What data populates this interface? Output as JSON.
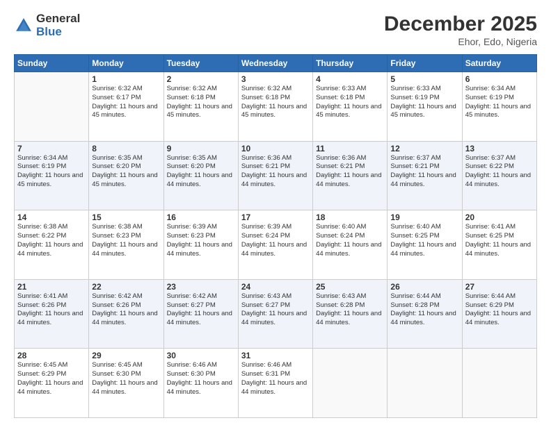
{
  "logo": {
    "line1": "General",
    "line2": "Blue"
  },
  "header": {
    "month": "December 2025",
    "location": "Ehor, Edo, Nigeria"
  },
  "weekdays": [
    "Sunday",
    "Monday",
    "Tuesday",
    "Wednesday",
    "Thursday",
    "Friday",
    "Saturday"
  ],
  "weeks": [
    [
      {
        "day": "",
        "sunrise": "",
        "sunset": "",
        "daylight": ""
      },
      {
        "day": "1",
        "sunrise": "Sunrise: 6:32 AM",
        "sunset": "Sunset: 6:17 PM",
        "daylight": "Daylight: 11 hours and 45 minutes."
      },
      {
        "day": "2",
        "sunrise": "Sunrise: 6:32 AM",
        "sunset": "Sunset: 6:18 PM",
        "daylight": "Daylight: 11 hours and 45 minutes."
      },
      {
        "day": "3",
        "sunrise": "Sunrise: 6:32 AM",
        "sunset": "Sunset: 6:18 PM",
        "daylight": "Daylight: 11 hours and 45 minutes."
      },
      {
        "day": "4",
        "sunrise": "Sunrise: 6:33 AM",
        "sunset": "Sunset: 6:18 PM",
        "daylight": "Daylight: 11 hours and 45 minutes."
      },
      {
        "day": "5",
        "sunrise": "Sunrise: 6:33 AM",
        "sunset": "Sunset: 6:19 PM",
        "daylight": "Daylight: 11 hours and 45 minutes."
      },
      {
        "day": "6",
        "sunrise": "Sunrise: 6:34 AM",
        "sunset": "Sunset: 6:19 PM",
        "daylight": "Daylight: 11 hours and 45 minutes."
      }
    ],
    [
      {
        "day": "7",
        "sunrise": "Sunrise: 6:34 AM",
        "sunset": "Sunset: 6:19 PM",
        "daylight": "Daylight: 11 hours and 45 minutes."
      },
      {
        "day": "8",
        "sunrise": "Sunrise: 6:35 AM",
        "sunset": "Sunset: 6:20 PM",
        "daylight": "Daylight: 11 hours and 45 minutes."
      },
      {
        "day": "9",
        "sunrise": "Sunrise: 6:35 AM",
        "sunset": "Sunset: 6:20 PM",
        "daylight": "Daylight: 11 hours and 44 minutes."
      },
      {
        "day": "10",
        "sunrise": "Sunrise: 6:36 AM",
        "sunset": "Sunset: 6:21 PM",
        "daylight": "Daylight: 11 hours and 44 minutes."
      },
      {
        "day": "11",
        "sunrise": "Sunrise: 6:36 AM",
        "sunset": "Sunset: 6:21 PM",
        "daylight": "Daylight: 11 hours and 44 minutes."
      },
      {
        "day": "12",
        "sunrise": "Sunrise: 6:37 AM",
        "sunset": "Sunset: 6:21 PM",
        "daylight": "Daylight: 11 hours and 44 minutes."
      },
      {
        "day": "13",
        "sunrise": "Sunrise: 6:37 AM",
        "sunset": "Sunset: 6:22 PM",
        "daylight": "Daylight: 11 hours and 44 minutes."
      }
    ],
    [
      {
        "day": "14",
        "sunrise": "Sunrise: 6:38 AM",
        "sunset": "Sunset: 6:22 PM",
        "daylight": "Daylight: 11 hours and 44 minutes."
      },
      {
        "day": "15",
        "sunrise": "Sunrise: 6:38 AM",
        "sunset": "Sunset: 6:23 PM",
        "daylight": "Daylight: 11 hours and 44 minutes."
      },
      {
        "day": "16",
        "sunrise": "Sunrise: 6:39 AM",
        "sunset": "Sunset: 6:23 PM",
        "daylight": "Daylight: 11 hours and 44 minutes."
      },
      {
        "day": "17",
        "sunrise": "Sunrise: 6:39 AM",
        "sunset": "Sunset: 6:24 PM",
        "daylight": "Daylight: 11 hours and 44 minutes."
      },
      {
        "day": "18",
        "sunrise": "Sunrise: 6:40 AM",
        "sunset": "Sunset: 6:24 PM",
        "daylight": "Daylight: 11 hours and 44 minutes."
      },
      {
        "day": "19",
        "sunrise": "Sunrise: 6:40 AM",
        "sunset": "Sunset: 6:25 PM",
        "daylight": "Daylight: 11 hours and 44 minutes."
      },
      {
        "day": "20",
        "sunrise": "Sunrise: 6:41 AM",
        "sunset": "Sunset: 6:25 PM",
        "daylight": "Daylight: 11 hours and 44 minutes."
      }
    ],
    [
      {
        "day": "21",
        "sunrise": "Sunrise: 6:41 AM",
        "sunset": "Sunset: 6:26 PM",
        "daylight": "Daylight: 11 hours and 44 minutes."
      },
      {
        "day": "22",
        "sunrise": "Sunrise: 6:42 AM",
        "sunset": "Sunset: 6:26 PM",
        "daylight": "Daylight: 11 hours and 44 minutes."
      },
      {
        "day": "23",
        "sunrise": "Sunrise: 6:42 AM",
        "sunset": "Sunset: 6:27 PM",
        "daylight": "Daylight: 11 hours and 44 minutes."
      },
      {
        "day": "24",
        "sunrise": "Sunrise: 6:43 AM",
        "sunset": "Sunset: 6:27 PM",
        "daylight": "Daylight: 11 hours and 44 minutes."
      },
      {
        "day": "25",
        "sunrise": "Sunrise: 6:43 AM",
        "sunset": "Sunset: 6:28 PM",
        "daylight": "Daylight: 11 hours and 44 minutes."
      },
      {
        "day": "26",
        "sunrise": "Sunrise: 6:44 AM",
        "sunset": "Sunset: 6:28 PM",
        "daylight": "Daylight: 11 hours and 44 minutes."
      },
      {
        "day": "27",
        "sunrise": "Sunrise: 6:44 AM",
        "sunset": "Sunset: 6:29 PM",
        "daylight": "Daylight: 11 hours and 44 minutes."
      }
    ],
    [
      {
        "day": "28",
        "sunrise": "Sunrise: 6:45 AM",
        "sunset": "Sunset: 6:29 PM",
        "daylight": "Daylight: 11 hours and 44 minutes."
      },
      {
        "day": "29",
        "sunrise": "Sunrise: 6:45 AM",
        "sunset": "Sunset: 6:30 PM",
        "daylight": "Daylight: 11 hours and 44 minutes."
      },
      {
        "day": "30",
        "sunrise": "Sunrise: 6:46 AM",
        "sunset": "Sunset: 6:30 PM",
        "daylight": "Daylight: 11 hours and 44 minutes."
      },
      {
        "day": "31",
        "sunrise": "Sunrise: 6:46 AM",
        "sunset": "Sunset: 6:31 PM",
        "daylight": "Daylight: 11 hours and 44 minutes."
      },
      {
        "day": "",
        "sunrise": "",
        "sunset": "",
        "daylight": ""
      },
      {
        "day": "",
        "sunrise": "",
        "sunset": "",
        "daylight": ""
      },
      {
        "day": "",
        "sunrise": "",
        "sunset": "",
        "daylight": ""
      }
    ]
  ]
}
